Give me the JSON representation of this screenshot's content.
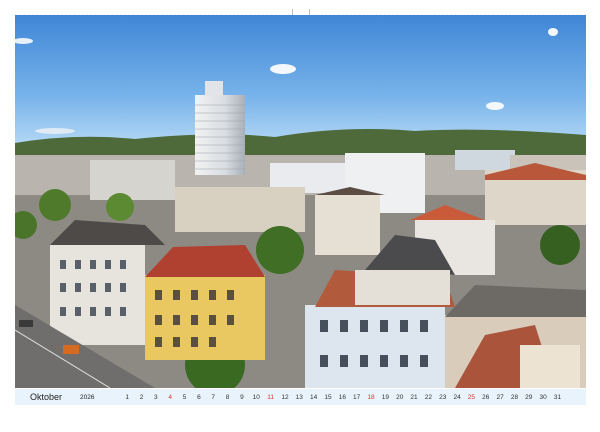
{
  "calendar": {
    "month": "Oktober",
    "year": "2026",
    "days": [
      {
        "n": "1",
        "sunday": false
      },
      {
        "n": "2",
        "sunday": false
      },
      {
        "n": "3",
        "sunday": false
      },
      {
        "n": "4",
        "sunday": true
      },
      {
        "n": "5",
        "sunday": false
      },
      {
        "n": "6",
        "sunday": false
      },
      {
        "n": "7",
        "sunday": false
      },
      {
        "n": "8",
        "sunday": false
      },
      {
        "n": "9",
        "sunday": false
      },
      {
        "n": "10",
        "sunday": false
      },
      {
        "n": "11",
        "sunday": true
      },
      {
        "n": "12",
        "sunday": false
      },
      {
        "n": "13",
        "sunday": false
      },
      {
        "n": "14",
        "sunday": false
      },
      {
        "n": "15",
        "sunday": false
      },
      {
        "n": "16",
        "sunday": false
      },
      {
        "n": "17",
        "sunday": false
      },
      {
        "n": "18",
        "sunday": true
      },
      {
        "n": "19",
        "sunday": false
      },
      {
        "n": "20",
        "sunday": false
      },
      {
        "n": "21",
        "sunday": false
      },
      {
        "n": "22",
        "sunday": false
      },
      {
        "n": "23",
        "sunday": false
      },
      {
        "n": "24",
        "sunday": false
      },
      {
        "n": "25",
        "sunday": true
      },
      {
        "n": "26",
        "sunday": false
      },
      {
        "n": "27",
        "sunday": false
      },
      {
        "n": "28",
        "sunday": false
      },
      {
        "n": "29",
        "sunday": false
      },
      {
        "n": "30",
        "sunday": false
      },
      {
        "n": "31",
        "sunday": false
      }
    ],
    "weekday_color": "#333333",
    "sunday_color": "#e0312d",
    "strip_color": "#e8f3fb"
  }
}
